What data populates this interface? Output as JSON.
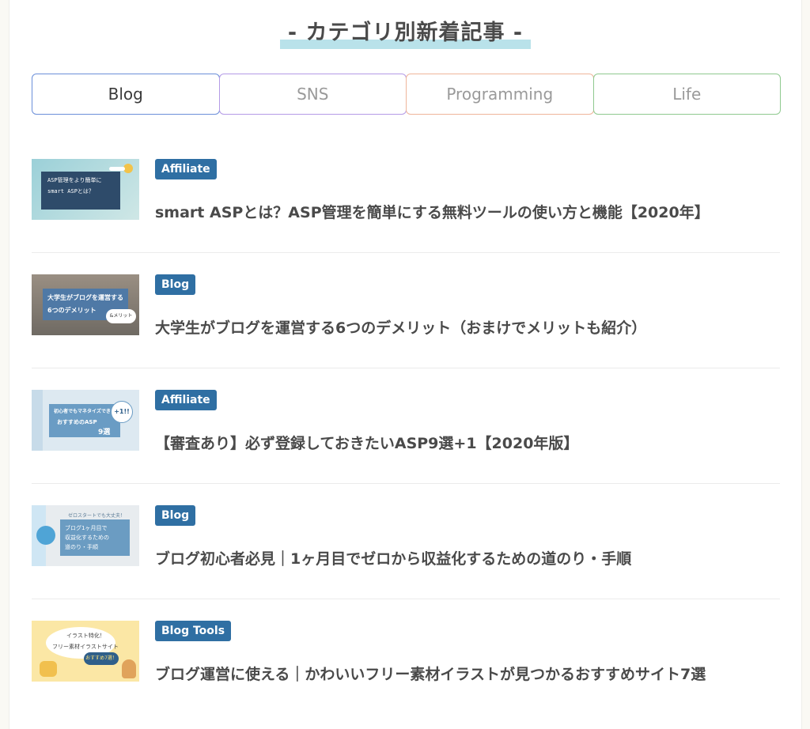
{
  "heading": "- カテゴリ別新着記事 -",
  "tabs": [
    "Blog",
    "SNS",
    "Programming",
    "Life"
  ],
  "articles": [
    {
      "category": "Affiliate",
      "title": "smart ASPとは？ASP管理を簡単にする無料ツールの使い方と機能【2020年】",
      "thumb_text": [
        "ASP管理をより簡単に",
        "smart ASPとは？"
      ]
    },
    {
      "category": "Blog",
      "title": "大学生がブログを運営する6つのデメリット（おまけでメリットも紹介）",
      "thumb_text": [
        "大学生がブログを運営する",
        "6つのデメリット",
        "&メリット"
      ]
    },
    {
      "category": "Affiliate",
      "title": "【審査あり】必ず登録しておきたいASP9選+1【2020年版】",
      "thumb_text": [
        "初心者でもマネタイズできる",
        "おすすめのASP",
        "9選",
        "+1!!"
      ]
    },
    {
      "category": "Blog",
      "title": "ブログ初心者必見｜1ヶ月目でゼロから収益化するための道のり・手順",
      "thumb_text": [
        "ゼロスタートでも大丈夫！",
        "ブログ1ヶ月目で",
        "収益化するための",
        "道のり・手順"
      ]
    },
    {
      "category": "Blog Tools",
      "title": "ブログ運営に使える｜かわいいフリー素材イラストが見つかるおすすめサイト7選",
      "thumb_text": [
        "イラスト特化！",
        "フリー素材イラストサイト",
        "おすすめ7選！"
      ]
    }
  ]
}
